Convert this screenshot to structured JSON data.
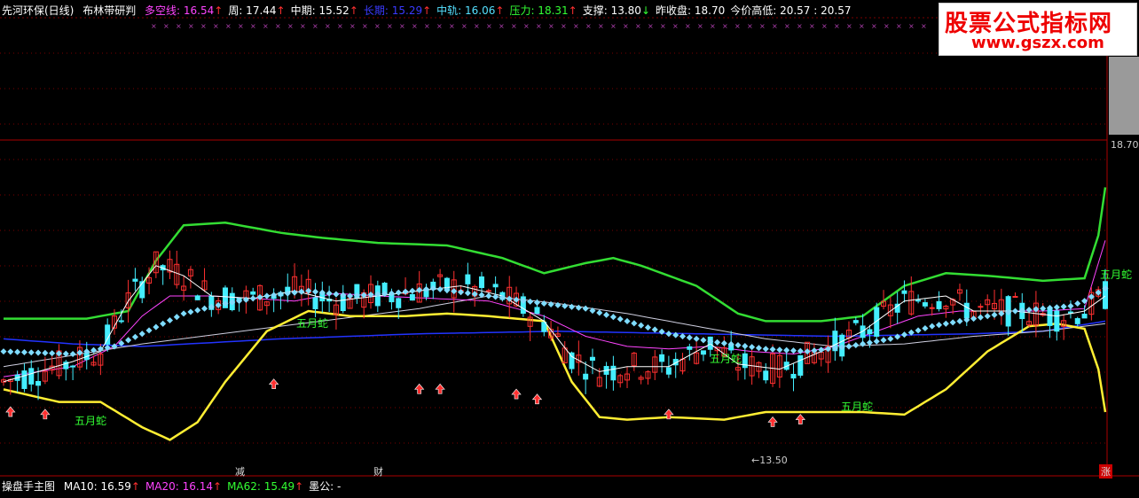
{
  "header": {
    "name": "先河环保(日线)",
    "indicator": "布林带研判",
    "items": [
      {
        "label": "多空线: 16.54",
        "color": "#ff44ff",
        "arrow": "↑",
        "arrow_color": "#ff3030"
      },
      {
        "label": "周: 17.44",
        "color": "#ffffff",
        "arrow": "↑",
        "arrow_color": "#ff3030"
      },
      {
        "label": "中期: 15.52",
        "color": "#ffffff",
        "arrow": "↑",
        "arrow_color": "#ff3030"
      },
      {
        "label": "长期: 15.29",
        "color": "#3a3aff",
        "arrow": "↑",
        "arrow_color": "#ff3030"
      },
      {
        "label": "中轨: 16.06",
        "color": "#55e0ff",
        "arrow": "↑",
        "arrow_color": "#ff3030"
      },
      {
        "label": "压力: 18.31",
        "color": "#33ff33",
        "arrow": "↑",
        "arrow_color": "#ff3030"
      },
      {
        "label": "支撑: 13.80",
        "color": "#ffffff",
        "arrow": "↓",
        "arrow_color": "#33ff33"
      },
      {
        "label": "昨收盘: 18.70",
        "color": "#ffffff",
        "arrow": "",
        "arrow_color": "#ffffff"
      },
      {
        "label": "今价高低: 20.57 : 20.57",
        "color": "#ffffff",
        "arrow": "",
        "arrow_color": "#ffffff"
      }
    ]
  },
  "footer": {
    "title": "操盘手主图",
    "items": [
      {
        "label": "MA10: 16.59",
        "color": "#ffffff",
        "arrow": "↑",
        "arrow_color": "#ff3030"
      },
      {
        "label": "MA20: 16.14",
        "color": "#ff44ff",
        "arrow": "↑",
        "arrow_color": "#ff3030"
      },
      {
        "label": "MA62: 15.49",
        "color": "#33ff33",
        "arrow": "↑",
        "arrow_color": "#ff3030"
      },
      {
        "label": "墨公: -",
        "color": "#ffffff",
        "arrow": "",
        "arrow_color": "#ffffff"
      }
    ]
  },
  "logo": {
    "line1": "股票公式指标网",
    "line2": "www.gszx.com"
  },
  "price_label": "18.70",
  "low_label": "13.50",
  "bottom_markers": [
    {
      "text": "减",
      "color": "#33ff33"
    },
    {
      "text": "财",
      "color": "#55e0ff"
    },
    {
      "text": "涨",
      "color": "#ffffff"
    }
  ],
  "annotations": [
    "五月蛇",
    "五月蛇",
    "五月蛇",
    "五月蛇",
    "五月蛇"
  ],
  "colors": {
    "up": "#ff3030",
    "down": "#44eeff",
    "upper_band": "#33dd33",
    "lower_band": "#ffee33",
    "ma_white": "#ffffff",
    "ma_magenta": "#ff44ff",
    "ma_blue": "#2233ff",
    "dots": "#7fdcff",
    "grid": "#7a0000"
  },
  "chart_data": {
    "type": "line",
    "ylim": [
      13.0,
      19.3
    ],
    "x_count": 160,
    "series": [
      {
        "name": "压力",
        "values_hint": "upper band, green, ~16.2 rising to 18.3"
      },
      {
        "name": "支撑",
        "values_hint": "lower band, yellow, ~13.8"
      }
    ],
    "bands": {
      "upper": [
        [
          0,
          15.85
        ],
        [
          12,
          15.85
        ],
        [
          18,
          16.0
        ],
        [
          22,
          17.0
        ],
        [
          26,
          17.7
        ],
        [
          32,
          17.75
        ],
        [
          40,
          17.55
        ],
        [
          46,
          17.45
        ],
        [
          54,
          17.35
        ],
        [
          64,
          17.3
        ],
        [
          72,
          17.05
        ],
        [
          78,
          16.75
        ],
        [
          84,
          16.95
        ],
        [
          88,
          17.05
        ],
        [
          92,
          16.9
        ],
        [
          100,
          16.5
        ],
        [
          106,
          15.95
        ],
        [
          110,
          15.8
        ],
        [
          118,
          15.8
        ],
        [
          124,
          15.9
        ],
        [
          130,
          16.5
        ],
        [
          136,
          16.75
        ],
        [
          142,
          16.7
        ],
        [
          150,
          16.6
        ],
        [
          156,
          16.65
        ],
        [
          158,
          17.5
        ],
        [
          159,
          18.45
        ]
      ],
      "lower": [
        [
          0,
          14.45
        ],
        [
          8,
          14.2
        ],
        [
          14,
          14.2
        ],
        [
          20,
          13.7
        ],
        [
          24,
          13.45
        ],
        [
          28,
          13.8
        ],
        [
          32,
          14.6
        ],
        [
          38,
          15.6
        ],
        [
          44,
          16.0
        ],
        [
          50,
          15.9
        ],
        [
          58,
          15.9
        ],
        [
          64,
          15.95
        ],
        [
          70,
          15.9
        ],
        [
          78,
          15.8
        ],
        [
          82,
          14.6
        ],
        [
          86,
          13.9
        ],
        [
          90,
          13.85
        ],
        [
          96,
          13.9
        ],
        [
          104,
          13.85
        ],
        [
          110,
          14.0
        ],
        [
          118,
          14.0
        ],
        [
          124,
          14.0
        ],
        [
          130,
          13.95
        ],
        [
          136,
          14.45
        ],
        [
          142,
          15.2
        ],
        [
          148,
          15.7
        ],
        [
          152,
          15.75
        ],
        [
          156,
          15.65
        ],
        [
          158,
          14.85
        ],
        [
          159,
          14.0
        ]
      ],
      "ma_white": [
        [
          0,
          14.6
        ],
        [
          10,
          15.0
        ],
        [
          14,
          15.2
        ],
        [
          18,
          16.2
        ],
        [
          22,
          16.9
        ],
        [
          26,
          16.7
        ],
        [
          30,
          16.3
        ],
        [
          36,
          16.25
        ],
        [
          42,
          16.4
        ],
        [
          48,
          16.2
        ],
        [
          54,
          16.3
        ],
        [
          60,
          16.4
        ],
        [
          66,
          16.5
        ],
        [
          72,
          16.3
        ],
        [
          78,
          15.8
        ],
        [
          82,
          15.1
        ],
        [
          86,
          14.8
        ],
        [
          90,
          14.9
        ],
        [
          96,
          14.9
        ],
        [
          102,
          15.35
        ],
        [
          106,
          14.95
        ],
        [
          112,
          14.85
        ],
        [
          118,
          15.2
        ],
        [
          124,
          15.6
        ],
        [
          130,
          16.2
        ],
        [
          136,
          16.3
        ],
        [
          140,
          16.0
        ],
        [
          146,
          16.0
        ],
        [
          152,
          15.9
        ],
        [
          156,
          16.0
        ],
        [
          159,
          16.3
        ]
      ],
      "ma_magenta": [
        [
          0,
          14.7
        ],
        [
          10,
          14.9
        ],
        [
          16,
          15.3
        ],
        [
          20,
          15.9
        ],
        [
          24,
          16.3
        ],
        [
          30,
          16.3
        ],
        [
          36,
          16.25
        ],
        [
          42,
          16.2
        ],
        [
          48,
          16.35
        ],
        [
          54,
          16.3
        ],
        [
          62,
          16.25
        ],
        [
          70,
          16.2
        ],
        [
          78,
          15.9
        ],
        [
          84,
          15.5
        ],
        [
          90,
          15.3
        ],
        [
          96,
          15.25
        ],
        [
          102,
          15.3
        ],
        [
          108,
          15.2
        ],
        [
          114,
          15.15
        ],
        [
          120,
          15.3
        ],
        [
          126,
          15.6
        ],
        [
          132,
          15.9
        ],
        [
          138,
          16.0
        ],
        [
          144,
          16.0
        ],
        [
          150,
          16.0
        ],
        [
          156,
          16.05
        ],
        [
          159,
          17.4
        ]
      ],
      "ma_blue": [
        [
          0,
          15.45
        ],
        [
          10,
          15.35
        ],
        [
          20,
          15.3
        ],
        [
          40,
          15.45
        ],
        [
          60,
          15.55
        ],
        [
          80,
          15.6
        ],
        [
          100,
          15.55
        ],
        [
          120,
          15.5
        ],
        [
          140,
          15.55
        ],
        [
          150,
          15.6
        ],
        [
          159,
          15.8
        ]
      ],
      "ma_gray": [
        [
          0,
          14.9
        ],
        [
          20,
          15.35
        ],
        [
          40,
          15.7
        ],
        [
          60,
          16.05
        ],
        [
          70,
          16.3
        ],
        [
          80,
          16.15
        ],
        [
          90,
          15.95
        ],
        [
          100,
          15.7
        ],
        [
          110,
          15.45
        ],
        [
          120,
          15.3
        ],
        [
          130,
          15.35
        ],
        [
          140,
          15.5
        ],
        [
          150,
          15.6
        ],
        [
          159,
          15.75
        ]
      ],
      "dots": [
        [
          0,
          15.2
        ],
        [
          10,
          15.15
        ],
        [
          16,
          15.3
        ],
        [
          20,
          15.55
        ],
        [
          26,
          15.95
        ],
        [
          32,
          16.15
        ],
        [
          38,
          16.3
        ],
        [
          44,
          16.4
        ],
        [
          50,
          16.3
        ],
        [
          56,
          16.35
        ],
        [
          62,
          16.45
        ],
        [
          70,
          16.3
        ],
        [
          78,
          16.15
        ],
        [
          84,
          16.05
        ],
        [
          90,
          15.8
        ],
        [
          96,
          15.55
        ],
        [
          102,
          15.4
        ],
        [
          110,
          15.25
        ],
        [
          116,
          15.2
        ],
        [
          122,
          15.3
        ],
        [
          128,
          15.45
        ],
        [
          134,
          15.7
        ],
        [
          140,
          15.85
        ],
        [
          146,
          16.0
        ],
        [
          150,
          16.05
        ],
        [
          154,
          16.1
        ],
        [
          156,
          16.2
        ],
        [
          159,
          16.45
        ]
      ]
    }
  }
}
